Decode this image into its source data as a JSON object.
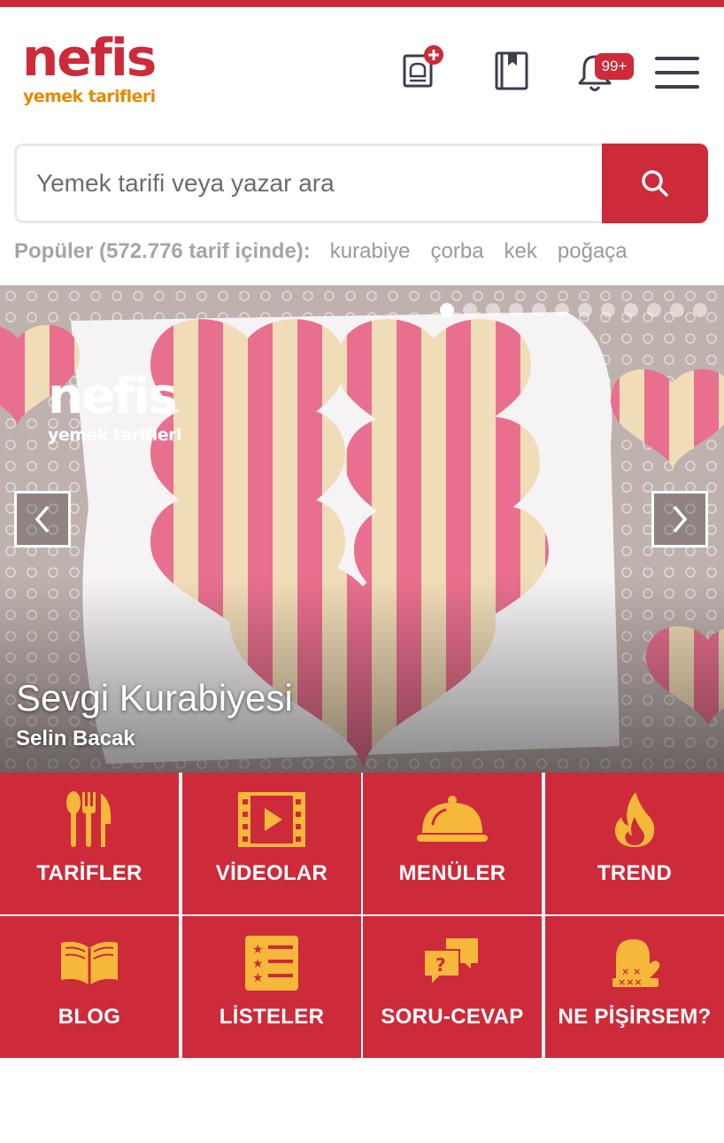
{
  "brand": {
    "name": "nefis",
    "tagline": "yemek tarifleri",
    "accent_color": "#cd2a3a",
    "tagline_color": "#e68a00"
  },
  "header": {
    "icons": [
      "add-recipe-icon",
      "recipe-book-icon",
      "bell-icon",
      "hamburger-menu-icon"
    ],
    "notification_badge": "99+"
  },
  "search": {
    "placeholder": "Yemek tarifi veya yazar ara",
    "value": "",
    "button_icon": "search-icon"
  },
  "popular": {
    "label": "Popüler (572.776 tarif içinde):",
    "links": [
      "kurabiye",
      "çorba",
      "kek",
      "poğaça"
    ]
  },
  "slider": {
    "title": "Sevgi Kurabiyesi",
    "author": "Selin Bacak",
    "watermark_main": "nefis",
    "watermark_sub": "yemek tarifleri",
    "active_slide": 1
  },
  "categories": [
    {
      "label": "TARİFLER",
      "icon": "utensils-icon"
    },
    {
      "label": "VİDEOLAR",
      "icon": "film-icon"
    },
    {
      "label": "MENÜLER",
      "icon": "cloche-icon"
    },
    {
      "label": "TREND",
      "icon": "flame-icon"
    },
    {
      "label": "BLOG",
      "icon": "open-book-icon"
    },
    {
      "label": "LİSTELER",
      "icon": "list-icon"
    },
    {
      "label": "SORU-CEVAP",
      "icon": "chat-bubbles-icon"
    },
    {
      "label": "NE PİŞİRSEM?",
      "icon": "oven-mitt-icon"
    }
  ]
}
